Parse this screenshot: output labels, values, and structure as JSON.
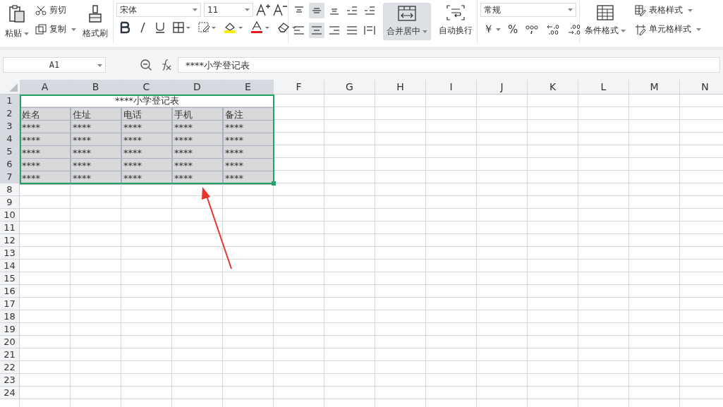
{
  "ribbon": {
    "clipboard": {
      "paste": "粘贴",
      "cut": "剪切",
      "copy": "复制",
      "format_painter": "格式刷"
    },
    "font": {
      "font_name": "宋体",
      "font_size": "11"
    },
    "alignment": {
      "buttons": [
        {
          "kind": "top",
          "selected": false
        },
        {
          "kind": "middle",
          "selected": true
        },
        {
          "kind": "bottom",
          "selected": false
        },
        {
          "kind": "outdent",
          "selected": false
        },
        {
          "kind": "indent",
          "selected": false
        },
        {
          "kind": "left",
          "selected": false
        },
        {
          "kind": "center",
          "selected": true
        },
        {
          "kind": "right",
          "selected": false
        },
        {
          "kind": "justify",
          "selected": false
        },
        {
          "kind": "distribute",
          "selected": false
        }
      ],
      "merge": {
        "label": "合并居中",
        "selected": true
      },
      "wrap": {
        "label": "自动换行",
        "selected": false
      }
    },
    "number": {
      "format": "常规",
      "currency": "￥",
      "percent": "%"
    },
    "styles": {
      "conditional": "条件格式",
      "table_style": "表格样式",
      "cell_style": "单元格样式"
    }
  },
  "formula_bar": {
    "cell_ref": "A1",
    "formula": "****小学登记表"
  },
  "sheet": {
    "columns": [
      {
        "label": "A",
        "selected": true
      },
      {
        "label": "B",
        "selected": true
      },
      {
        "label": "C",
        "selected": true
      },
      {
        "label": "D",
        "selected": true
      },
      {
        "label": "E",
        "selected": true
      },
      {
        "label": "F",
        "selected": false
      },
      {
        "label": "G",
        "selected": false
      },
      {
        "label": "H",
        "selected": false
      },
      {
        "label": "I",
        "selected": false
      },
      {
        "label": "J",
        "selected": false
      },
      {
        "label": "K",
        "selected": false
      },
      {
        "label": "L",
        "selected": false
      },
      {
        "label": "M",
        "selected": false
      },
      {
        "label": "N",
        "selected": false
      }
    ],
    "rows": [
      {
        "label": "1",
        "selected": true,
        "merged": "****小学登记表"
      },
      {
        "label": "2",
        "selected": true,
        "cells": [
          "姓名",
          "住址",
          "电话",
          "手机",
          "备注"
        ]
      },
      {
        "label": "3",
        "selected": true,
        "cells": [
          "****",
          "****",
          "****",
          "****",
          "****"
        ]
      },
      {
        "label": "4",
        "selected": true,
        "cells": [
          "****",
          "****",
          "****",
          "****",
          "****"
        ]
      },
      {
        "label": "5",
        "selected": true,
        "cells": [
          "****",
          "****",
          "****",
          "****",
          "****"
        ]
      },
      {
        "label": "6",
        "selected": true,
        "cells": [
          "****",
          "****",
          "****",
          "****",
          "****"
        ]
      },
      {
        "label": "7",
        "selected": true,
        "cells": [
          "****",
          "****",
          "****",
          "****",
          "****"
        ]
      },
      {
        "label": "8",
        "selected": false
      },
      {
        "label": "9",
        "selected": false
      },
      {
        "label": "10",
        "selected": false
      },
      {
        "label": "11",
        "selected": false
      },
      {
        "label": "12",
        "selected": false
      },
      {
        "label": "13",
        "selected": false
      },
      {
        "label": "14",
        "selected": false
      },
      {
        "label": "15",
        "selected": false
      },
      {
        "label": "16",
        "selected": false
      },
      {
        "label": "17",
        "selected": false
      },
      {
        "label": "18",
        "selected": false
      },
      {
        "label": "19",
        "selected": false
      },
      {
        "label": "20",
        "selected": false
      },
      {
        "label": "21",
        "selected": false
      },
      {
        "label": "22",
        "selected": false
      },
      {
        "label": "23",
        "selected": false
      },
      {
        "label": "24",
        "selected": false
      }
    ]
  }
}
